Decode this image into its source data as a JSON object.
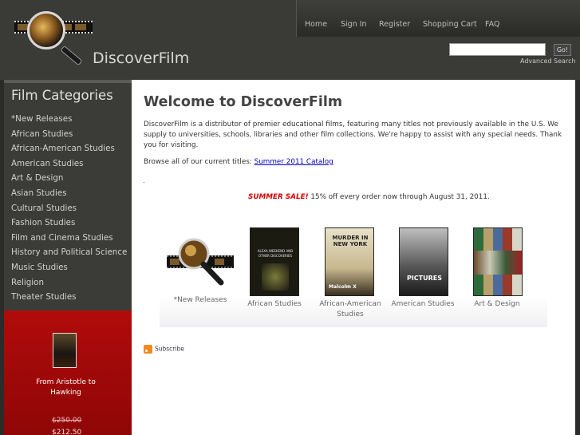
{
  "site": {
    "name": "DiscoverFilm"
  },
  "nav": {
    "items": [
      "Home",
      "Sign In",
      "Register",
      "Shopping Cart",
      "FAQ"
    ]
  },
  "search": {
    "placeholder": "",
    "button": "Go!",
    "advanced": "Advanced Search"
  },
  "sidebar": {
    "title": "Film Categories",
    "items": [
      "*New Releases",
      "African Studies",
      "African-American Studies",
      "American Studies",
      "Art & Design",
      "Asian Studies",
      "Cultural Studies",
      "Fashion Studies",
      "Film and Cinema Studies",
      "History and Political Science",
      "Music Studies",
      "Religion",
      "Theater Studies"
    ]
  },
  "promo": {
    "title": "From Aristotle to Hawking",
    "old_price": "$250.00",
    "new_price": "$212.50"
  },
  "main": {
    "title": "Welcome to DiscoverFilm",
    "intro": "DiscoverFilm is a distributor of premier educational films, featuring many titles not previously available in the U.S.  We supply to universities, schools, libraries and other film collections.  We're happy to assist with any special needs.  Thank you for visiting.",
    "browse_text": "Browse all of our current titles: ",
    "browse_link": "Summer 2011 Catalog",
    "dot": ".",
    "sale_label": "SUMMER SALE!",
    "sale_text": " 15% off every order now through August 31, 2011.",
    "books": [
      {
        "label": "*New Releases"
      },
      {
        "label": "African Studies",
        "cover_text": "ALEXA WEEKEND AND OTHER DISCOVERIES"
      },
      {
        "label": "African-American Studies",
        "cover_text": "MURDER IN NEW YORK",
        "cover_sub": "Malcolm X"
      },
      {
        "label": "American Studies",
        "cover_text": "PICTURES"
      },
      {
        "label": "Art & Design"
      }
    ],
    "subscribe": "Subscribe"
  }
}
